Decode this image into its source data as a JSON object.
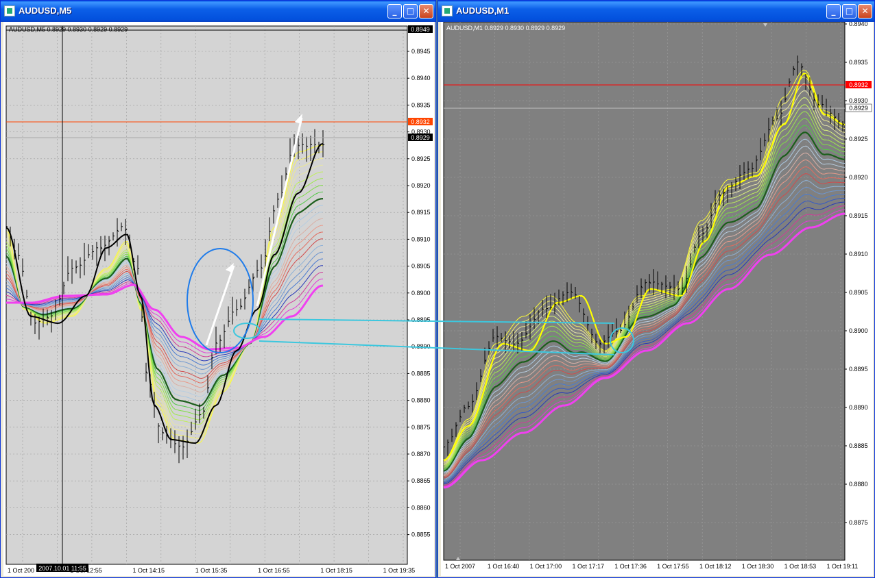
{
  "left_window": {
    "title": "AUDUSD,M5",
    "header": "AUDUSD,M5  0.8929 0.8930 0.8929 0.8929",
    "price_labels": [
      "0.8945",
      "0.8940",
      "0.8935",
      "0.8930",
      "0.8925",
      "0.8920",
      "0.8915",
      "0.8910",
      "0.8905",
      "0.8900",
      "0.8895",
      "0.8890",
      "0.8885",
      "0.8880",
      "0.8875",
      "0.8870",
      "0.8865",
      "0.8860",
      "0.8855"
    ],
    "top_tag": "0.8949",
    "ask_tag": "0.8932",
    "bid_tag": "0.8929",
    "time_labels": [
      "1 Oct 200",
      "1 Oct 12:55",
      "1 Oct 14:15",
      "1 Oct 15:35",
      "1 Oct 16:55",
      "1 Oct 18:15",
      "1 Oct 19:35"
    ],
    "crosshair_time": "2007.10.01 11:55",
    "colors": {
      "chart_bg": "#d4d4d4",
      "ask_line": "#ff4500",
      "bid_line": "#a8a8a8"
    }
  },
  "right_window": {
    "title": "AUDUSD,M1",
    "header": "AUDUSD,M1  0.8929 0.8930 0.8929 0.8929",
    "price_labels": [
      "0.8940",
      "0.8935",
      "0.8930",
      "0.8925",
      "0.8920",
      "0.8915",
      "0.8910",
      "0.8905",
      "0.8900",
      "0.8895",
      "0.8890",
      "0.8885",
      "0.8880",
      "0.8875"
    ],
    "ask_tag": "0.8932",
    "bid_tag": "0.8929",
    "time_labels": [
      "1 Oct 2007",
      "1 Oct 16:40",
      "1 Oct 17:00",
      "1 Oct 17:17",
      "1 Oct 17:36",
      "1 Oct 17:55",
      "1 Oct 18:12",
      "1 Oct 18:30",
      "1 Oct 18:53",
      "1 Oct 19:11"
    ],
    "colors": {
      "chart_bg": "#808080",
      "ask_line": "#ff0000",
      "bid_line": "#c0c0c0"
    }
  },
  "buttons": {
    "minimize": "_",
    "maximize": "□",
    "close": "✕"
  },
  "icons": [
    "window-icon",
    "minimize-icon",
    "maximize-icon",
    "close-icon"
  ]
}
